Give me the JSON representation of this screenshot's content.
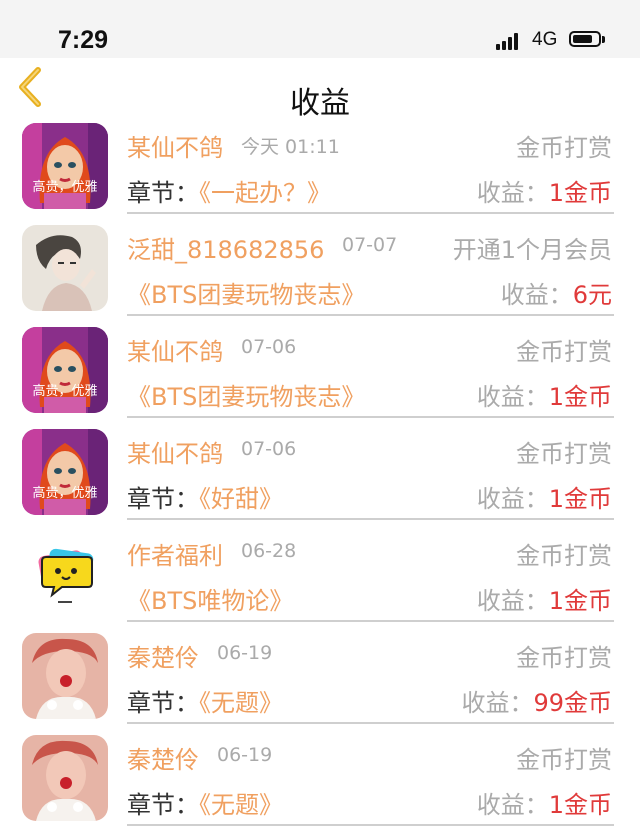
{
  "status_bar": {
    "time": "7:29",
    "network": "4G"
  },
  "header": {
    "title": "收益"
  },
  "records": [
    {
      "name": "某仙不鸽",
      "date": "今天 01:11",
      "type": "金币打赏",
      "chapter_label": "章节：",
      "chapter_title": "《一起办？》",
      "income_label": "收益：",
      "income_value": "1金币",
      "avatar_kind": "doll",
      "avatar_caption": "高贵，优雅"
    },
    {
      "name": "泛甜_818682856",
      "date": "07-07",
      "type": "开通1个月会员",
      "chapter_label": "",
      "chapter_title": "《BTS团妻玩物丧志》",
      "income_label": "收益：",
      "income_value": "6元",
      "avatar_kind": "sketch",
      "avatar_caption": ""
    },
    {
      "name": "某仙不鸽",
      "date": "07-06",
      "type": "金币打赏",
      "chapter_label": "",
      "chapter_title": "《BTS团妻玩物丧志》",
      "income_label": "收益：",
      "income_value": "1金币",
      "avatar_kind": "doll",
      "avatar_caption": "高贵，优雅"
    },
    {
      "name": "某仙不鸽",
      "date": "07-06",
      "type": "金币打赏",
      "chapter_label": "章节：",
      "chapter_title": "《好甜》",
      "income_label": "收益：",
      "income_value": "1金币",
      "avatar_kind": "doll",
      "avatar_caption": "高贵，优雅"
    },
    {
      "name": "作者福利",
      "date": "06-28",
      "type": "金币打赏",
      "chapter_label": "",
      "chapter_title": "《BTS唯物论》",
      "income_label": "收益：",
      "income_value": "1金币",
      "avatar_kind": "bubble",
      "avatar_caption": ""
    },
    {
      "name": "秦楚伶",
      "date": "06-19",
      "type": "金币打赏",
      "chapter_label": "章节：",
      "chapter_title": "《无题》",
      "income_label": "收益：",
      "income_value": "99金币",
      "avatar_kind": "photo",
      "avatar_caption": ""
    },
    {
      "name": "秦楚伶",
      "date": "06-19",
      "type": "金币打赏",
      "chapter_label": "章节：",
      "chapter_title": "《无题》",
      "income_label": "收益：",
      "income_value": "1金币",
      "avatar_kind": "photo",
      "avatar_caption": ""
    }
  ],
  "colors": {
    "name": "#f0a060",
    "muted": "#aaaaaa",
    "amount": "#e03a3a",
    "back": "#e8b020"
  }
}
